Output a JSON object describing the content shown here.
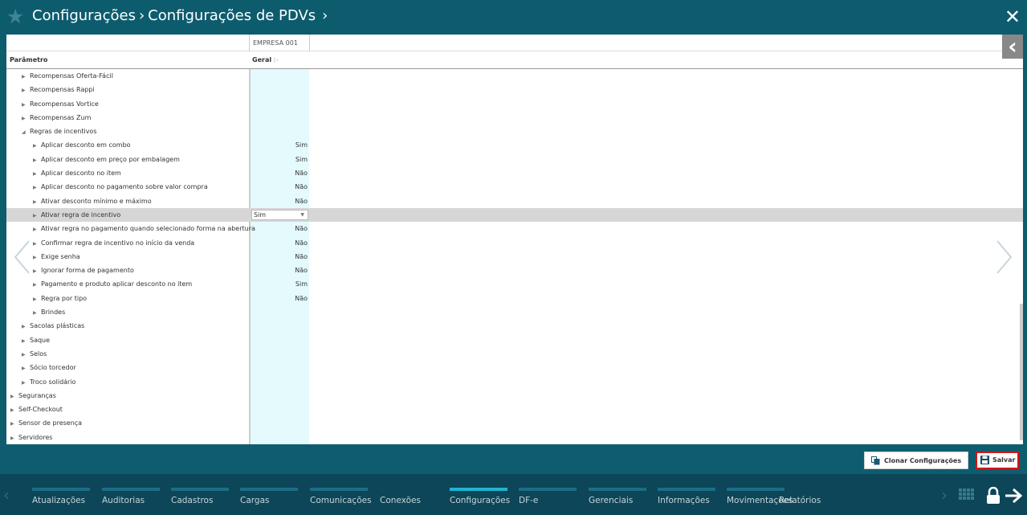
{
  "header": {
    "crumb1": "Configurações",
    "crumb2": "Configurações de PDVs"
  },
  "columns": {
    "empresa": "EMPRESA 001",
    "parametro": "Parâmetro",
    "geral": "Geral"
  },
  "rows": [
    {
      "label": "Recompensas Oferta-Fácil",
      "value": ""
    },
    {
      "label": "Recompensas Rappi",
      "value": ""
    },
    {
      "label": "Recompensas Vortice",
      "value": ""
    },
    {
      "label": "Recompensas Zum",
      "value": ""
    },
    {
      "label": "Regras de incentivos",
      "value": ""
    },
    {
      "label": "Aplicar desconto em combo",
      "value": "Sim"
    },
    {
      "label": "Aplicar desconto em preço por embalagem",
      "value": "Sim"
    },
    {
      "label": "Aplicar desconto no item",
      "value": "Não"
    },
    {
      "label": "Aplicar desconto no pagamento sobre valor compra",
      "value": "Não"
    },
    {
      "label": "Ativar desconto mínimo e máximo",
      "value": "Não"
    },
    {
      "label": "Ativar regra de incentivo",
      "value": "Sim"
    },
    {
      "label": "Ativar regra no pagamento quando selecionado forma na abertura",
      "value": "Não"
    },
    {
      "label": "Confirmar regra de incentivo no início da venda",
      "value": "Não"
    },
    {
      "label": "Exige senha",
      "value": "Não"
    },
    {
      "label": "Ignorar forma de pagamento",
      "value": "Não"
    },
    {
      "label": "Pagamento e produto aplicar desconto no item",
      "value": "Sim"
    },
    {
      "label": "Regra por tipo",
      "value": "Não"
    },
    {
      "label": "Brindes",
      "value": ""
    },
    {
      "label": "Sacolas plásticas",
      "value": ""
    },
    {
      "label": "Saque",
      "value": ""
    },
    {
      "label": "Selos",
      "value": ""
    },
    {
      "label": "Sócio torcedor",
      "value": ""
    },
    {
      "label": "Troco solidário",
      "value": ""
    },
    {
      "label": "Seguranças",
      "value": ""
    },
    {
      "label": "Self-Checkout",
      "value": ""
    },
    {
      "label": "Sensor de presença",
      "value": ""
    },
    {
      "label": "Servidores",
      "value": ""
    }
  ],
  "buttons": {
    "clone": "Clonar Configurações",
    "save": "Salvar"
  },
  "tabs": [
    "Atualizações",
    "Auditorias",
    "Cadastros",
    "Cargas",
    "Comunicações",
    "Conexões",
    "Configurações",
    "DF-e",
    "Gerenciais",
    "Informações",
    "Movimentações",
    "Relatórios"
  ],
  "active_tab": "Configurações",
  "colors": {
    "header_bg": "#0d5c6e",
    "footer_bg": "#0c4658",
    "active_tab": "#1eb6d1",
    "geral_column": "#e4fafc",
    "save_border": "#d01818"
  }
}
